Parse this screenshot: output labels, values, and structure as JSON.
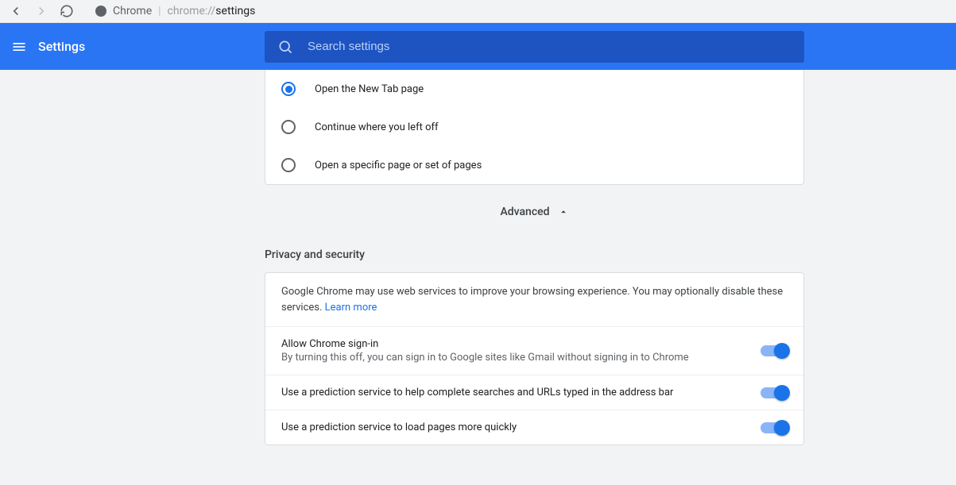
{
  "browser": {
    "label": "Chrome",
    "url_prefix": "chrome://",
    "url_path": "settings"
  },
  "header": {
    "title": "Settings"
  },
  "search": {
    "placeholder": "Search settings"
  },
  "startup": {
    "options": [
      {
        "label": "Open the New Tab page",
        "selected": true
      },
      {
        "label": "Continue where you left off",
        "selected": false
      },
      {
        "label": "Open a specific page or set of pages",
        "selected": false
      }
    ]
  },
  "advanced": {
    "label": "Advanced"
  },
  "privacy": {
    "section_title": "Privacy and security",
    "intro_text": "Google Chrome may use web services to improve your browsing experience. You may optionally disable these services. ",
    "learn_more": "Learn more",
    "rows": [
      {
        "title": "Allow Chrome sign-in",
        "subtitle": "By turning this off, you can sign in to Google sites like Gmail without signing in to Chrome",
        "enabled": true
      },
      {
        "title": "Use a prediction service to help complete searches and URLs typed in the address bar",
        "subtitle": "",
        "enabled": true
      },
      {
        "title": "Use a prediction service to load pages more quickly",
        "subtitle": "",
        "enabled": true
      }
    ]
  }
}
